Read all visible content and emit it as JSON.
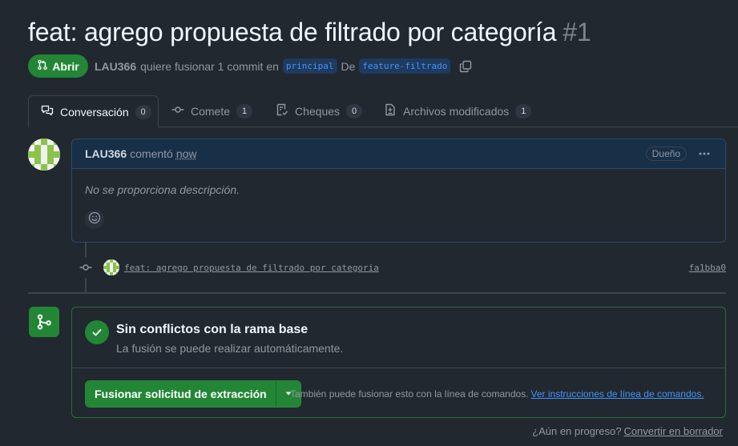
{
  "pr": {
    "title": "feat: agrego propuesta de filtrado por categoría",
    "number": "#1",
    "state": "Abrir",
    "author": "LAU366",
    "merge_text": "quiere fusionar 1 commit en",
    "base_branch": "principal",
    "from_text": "De",
    "head_branch": "feature-filtrado"
  },
  "tabs": [
    {
      "label": "Conversación",
      "count": "0"
    },
    {
      "label": "Comete",
      "count": "1"
    },
    {
      "label": "Cheques",
      "count": "0"
    },
    {
      "label": "Archivos modificados",
      "count": "1"
    }
  ],
  "comment": {
    "author": "LAU366",
    "action": "comentó",
    "time": "now",
    "role": "Dueño",
    "body": "No se proporciona descripción."
  },
  "commit": {
    "message": "feat: agrego propuesta de filtrado por categoria",
    "sha": "fa1bba0"
  },
  "merge": {
    "title": "Sin conflictos con la rama base",
    "subtitle": "La fusión se puede realizar automáticamente.",
    "button": "Fusionar solicitud de extracción",
    "hint": "También puede fusionar esto con la línea de comandos.",
    "hint_link": "Ver instrucciones de línea de comandos."
  },
  "draft": {
    "question": "¿Aún en progreso?",
    "link": "Convertir en borrador"
  },
  "colors": {
    "background": "#212830",
    "accent_green": "#238636",
    "link_blue": "#4493f8"
  }
}
